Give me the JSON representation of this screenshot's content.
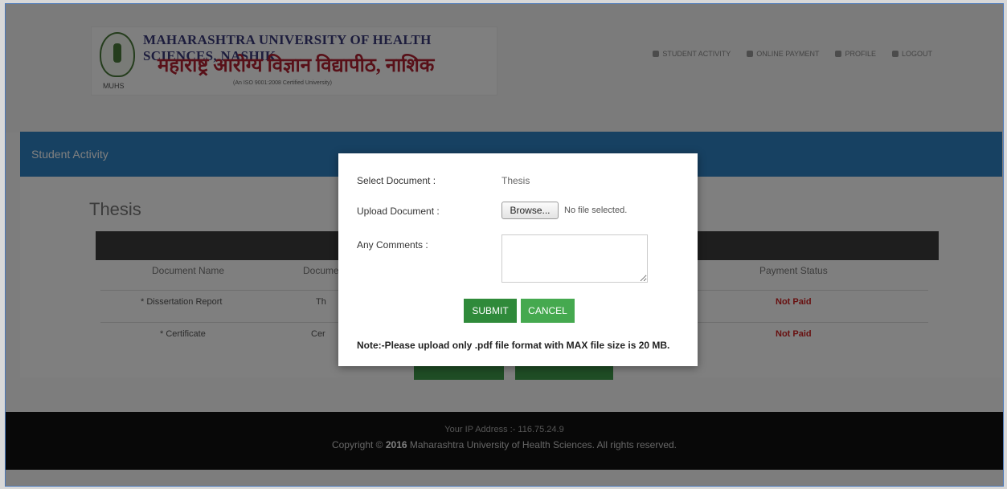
{
  "header": {
    "logo_abbr": "MUHS",
    "title_en": "MAHARASHTRA UNIVERSITY OF HEALTH SCIENCES, NASHIK",
    "title_mr": "महाराष्ट्र आरोग्य विज्ञान विद्यापीठ, नाशिक",
    "certification": "(An ISO 9001:2008 Certified University)",
    "nav": [
      {
        "label": "STUDENT ACTIVITY",
        "icon": "activity-icon"
      },
      {
        "label": "ONLINE PAYMENT",
        "icon": "payment-icon"
      },
      {
        "label": "PROFILE",
        "icon": "user-icon"
      },
      {
        "label": "LOGOUT",
        "icon": "logout-icon"
      }
    ]
  },
  "section_bar": {
    "label": "Student Activity"
  },
  "page": {
    "heading": "Thesis",
    "columns": [
      "Document Name",
      "Document",
      "Payment Status"
    ],
    "rows": [
      {
        "name": "* Dissertation Report",
        "doc": "Th",
        "status": "Not Paid"
      },
      {
        "name": "* Certificate",
        "doc": "Cer",
        "status": "Not Paid"
      }
    ]
  },
  "footer": {
    "ip": "Your IP Address :- 116.75.24.9",
    "copyright_prefix": "Copyright © ",
    "year": "2016",
    "copyright_suffix": " Maharashtra University of Health Sciences. All rights reserved."
  },
  "modal": {
    "select_label": "Select Document :",
    "select_value": "Thesis",
    "upload_label": "Upload Document :",
    "browse_label": "Browse...",
    "no_file": "No file selected.",
    "comments_label": "Any Comments :",
    "comments_value": "",
    "submit_label": "SUBMIT",
    "cancel_label": "CANCEL",
    "note": "Note:-Please upload only .pdf file format with MAX file size is 20 MB."
  }
}
